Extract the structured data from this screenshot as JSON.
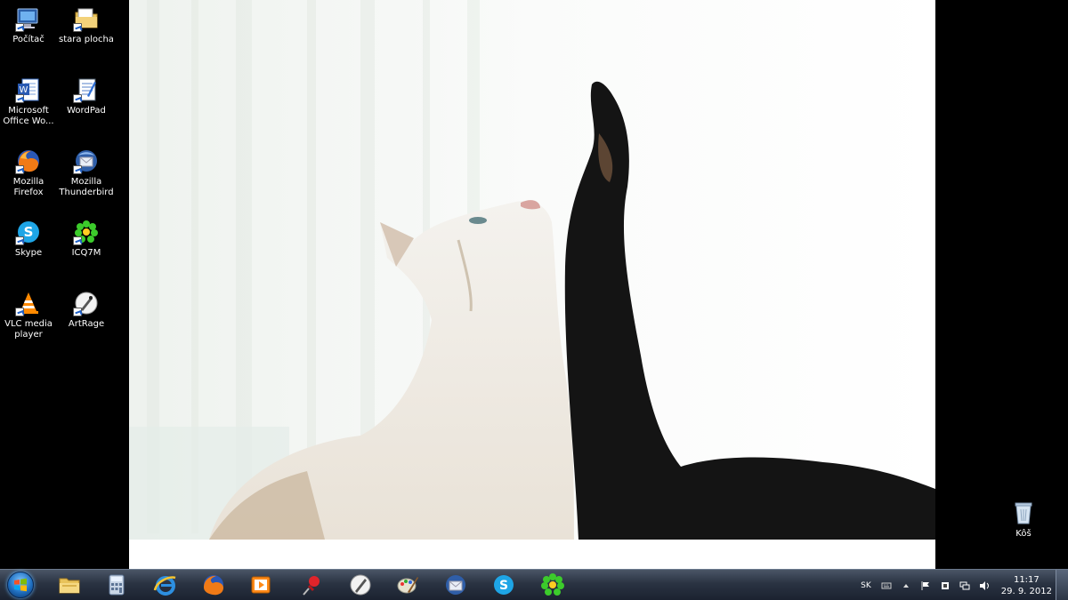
{
  "desktop": {
    "icons": [
      {
        "label": "Počítač",
        "icon": "computer-icon"
      },
      {
        "label": "stara plocha",
        "icon": "folder-icon"
      },
      {
        "label": "Microsoft\nOffice Wo...",
        "icon": "word-icon"
      },
      {
        "label": "WordPad",
        "icon": "wordpad-icon"
      },
      {
        "label": "Mozilla\nFirefox",
        "icon": "firefox-icon"
      },
      {
        "label": "Mozilla\nThunderbird",
        "icon": "thunderbird-icon"
      },
      {
        "label": "Skype",
        "icon": "skype-icon"
      },
      {
        "label": "ICQ7M",
        "icon": "icq-icon"
      },
      {
        "label": "VLC media\nplayer",
        "icon": "vlc-icon"
      },
      {
        "label": "ArtRage",
        "icon": "artrage-icon"
      }
    ],
    "recycle_bin": {
      "label": "Kôš",
      "icon": "recycle-bin-icon"
    }
  },
  "taskbar": {
    "pinned": [
      {
        "name": "explorer",
        "icon": "folder-icon"
      },
      {
        "name": "calculator",
        "icon": "calculator-icon"
      },
      {
        "name": "internet-explorer",
        "icon": "ie-icon"
      },
      {
        "name": "firefox",
        "icon": "firefox-icon"
      },
      {
        "name": "media-player",
        "icon": "media-player-icon"
      },
      {
        "name": "pin",
        "icon": "pushpin-icon"
      },
      {
        "name": "artrage",
        "icon": "artrage-icon"
      },
      {
        "name": "paint",
        "icon": "paint-icon"
      },
      {
        "name": "thunderbird",
        "icon": "thunderbird-icon"
      },
      {
        "name": "skype",
        "icon": "skype-icon"
      },
      {
        "name": "icq",
        "icon": "icq-icon"
      }
    ],
    "tray": {
      "language": "SK",
      "time": "11:17",
      "date": "29. 9. 2012"
    }
  },
  "colors": {
    "taskbar": "#2a3342",
    "desktop_bg": "#000000",
    "accent": "#1f6fc1"
  }
}
